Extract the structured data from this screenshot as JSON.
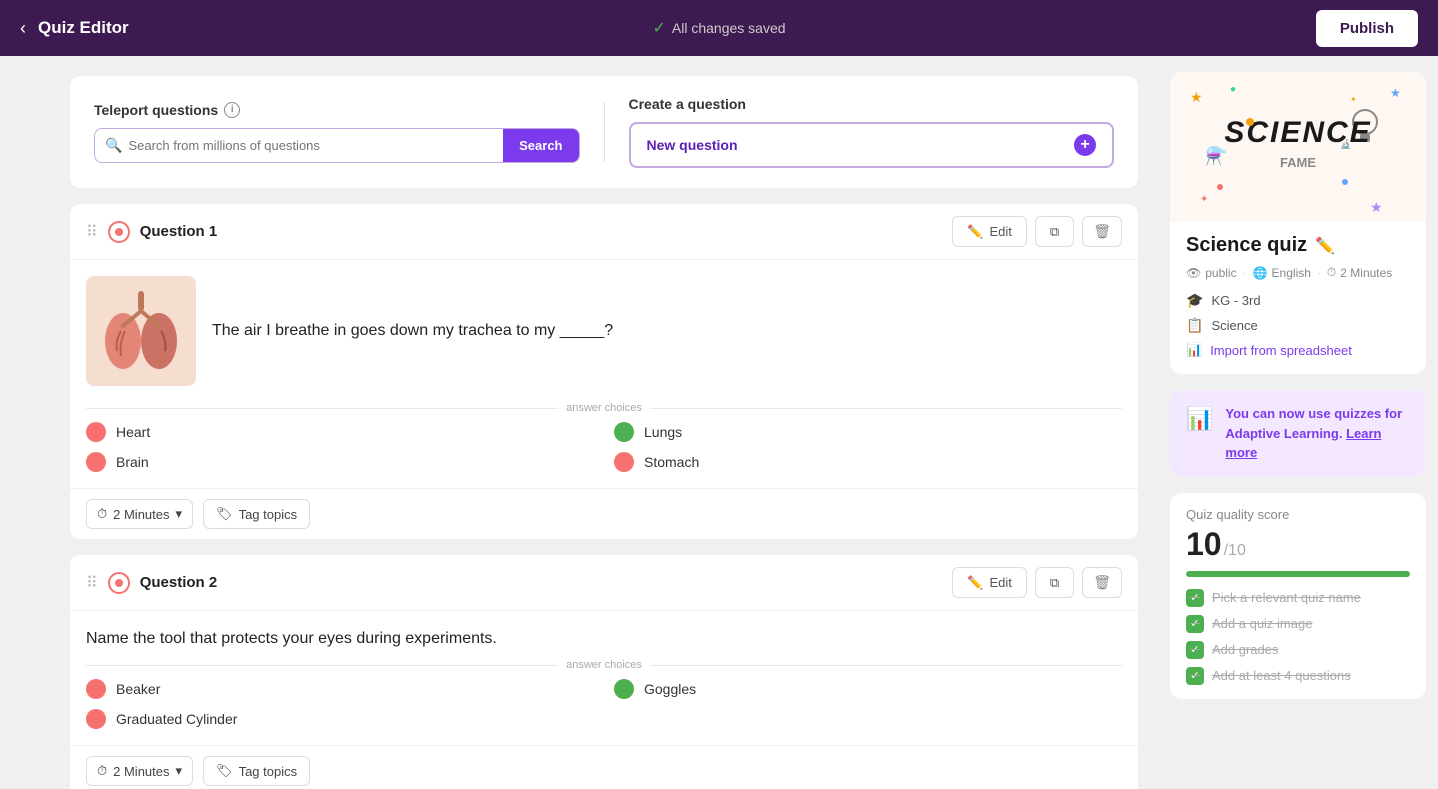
{
  "header": {
    "back_icon": "‹",
    "title": "Quiz Editor",
    "status": "All changes saved",
    "publish_label": "Publish"
  },
  "teleport": {
    "label": "Teleport questions",
    "search_placeholder": "Search from millions of questions",
    "search_btn": "Search"
  },
  "create": {
    "label": "Create a question",
    "new_question_btn": "New question"
  },
  "questions": [
    {
      "id": "question-1",
      "label": "Question 1",
      "text": "The air I breathe in goes down my trachea to my _____?",
      "has_image": true,
      "answer_choices_label": "answer choices",
      "choices": [
        {
          "label": "Heart",
          "correct": false
        },
        {
          "label": "Lungs",
          "correct": true
        },
        {
          "label": "Brain",
          "correct": false
        },
        {
          "label": "Stomach",
          "correct": false
        }
      ],
      "time": "2 Minutes",
      "tag_topics": "Tag topics",
      "edit_btn": "Edit",
      "actions": {
        "edit": "Edit"
      }
    },
    {
      "id": "question-2",
      "label": "Question 2",
      "text": "Name the tool that protects your eyes during experiments.",
      "has_image": false,
      "answer_choices_label": "answer choices",
      "choices": [
        {
          "label": "Beaker",
          "correct": false
        },
        {
          "label": "Goggles",
          "correct": true
        },
        {
          "label": "Graduated Cylinder",
          "correct": false
        }
      ],
      "time": "2 Minutes",
      "tag_topics": "Tag topics",
      "edit_btn": "Edit",
      "actions": {
        "edit": "Edit"
      }
    }
  ],
  "sidebar": {
    "quiz_name": "Science quiz",
    "edit_icon": "✏️",
    "meta": {
      "visibility": "public",
      "language": "English",
      "duration": "2 Minutes"
    },
    "details": {
      "grade": "KG - 3rd",
      "subject": "Science",
      "spreadsheet": "Import from spreadsheet"
    },
    "adaptive": {
      "text": "You can now use quizzes for Adaptive Learning.",
      "link": "Learn more"
    },
    "quality": {
      "label": "Quiz quality score",
      "score": "10",
      "denom": "/10",
      "bar_pct": 100,
      "items": [
        "Pick a relevant quiz name",
        "Add a quiz image",
        "Add grades",
        "Add at least 4 questions"
      ]
    }
  }
}
